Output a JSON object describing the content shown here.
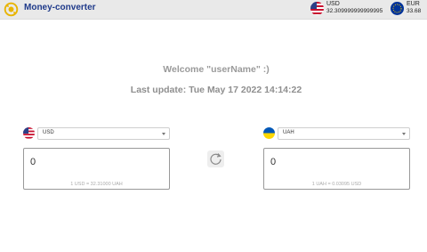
{
  "header": {
    "app_title": "Money-converter",
    "rates": [
      {
        "code": "USD",
        "value": "32.309999999999995"
      },
      {
        "code": "EUR",
        "value": "33.68"
      }
    ]
  },
  "main": {
    "welcome": "Welcome \"userName\" :)",
    "last_update": "Last update: Tue May 17 2022 14:14:22"
  },
  "converter": {
    "from": {
      "currency": "USD",
      "amount": "0",
      "rate_hint": "1 USD = 32.31000 UAH"
    },
    "to": {
      "currency": "UAH",
      "amount": "0",
      "rate_hint": "1 UAH = 0.03095 USD"
    }
  },
  "icons": [
    "logo-icon",
    "us-flag-icon",
    "eu-flag-icon",
    "ua-flag-icon",
    "swap-icon",
    "chevron-down-icon"
  ],
  "colors": {
    "brand": "#1f3a8a",
    "header_bg": "#e9e9e9",
    "logo": "#e8b400"
  }
}
